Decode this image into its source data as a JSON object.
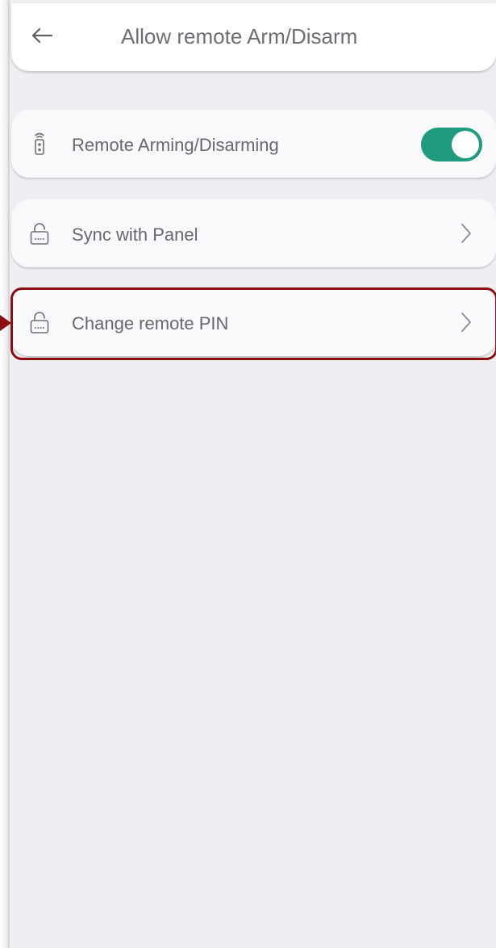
{
  "header": {
    "title": "Allow remote Arm/Disarm",
    "back_icon": "arrow-left-icon"
  },
  "settings": [
    {
      "label": "Remote Arming/Disarming",
      "icon": "remote-control-icon",
      "control": "toggle",
      "toggle_on": true
    },
    {
      "label": "Sync with Panel",
      "icon": "lock-icon",
      "control": "chevron-right-icon"
    },
    {
      "label": "Change remote PIN",
      "icon": "lock-icon",
      "control": "chevron-right-icon",
      "highlighted": true
    }
  ],
  "colors": {
    "background": "#efeff3",
    "card": "#f9f9fb",
    "text": "#666772",
    "toggle_on": "#1e9a7e",
    "highlight": "#8b0e12"
  }
}
